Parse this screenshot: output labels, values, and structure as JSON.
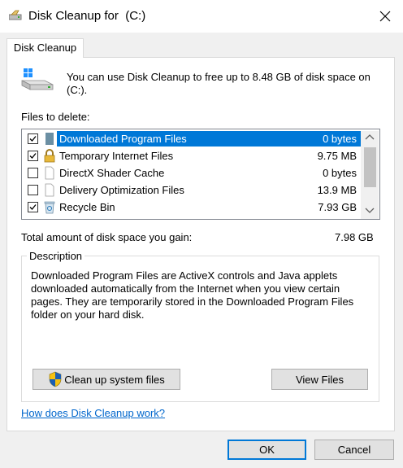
{
  "window": {
    "title": "Disk Cleanup for  (C:)",
    "icon": "disk-cleanup-icon",
    "close_icon": "close-icon"
  },
  "tabs": [
    {
      "label": "Disk Cleanup",
      "active": true
    }
  ],
  "intro_text": "You can use Disk Cleanup to free up to 8.48 GB of disk space on (C:).",
  "files_label": "Files to delete:",
  "files": [
    {
      "name": "Downloaded Program Files",
      "size": "0 bytes",
      "checked": true,
      "selected": true,
      "icon": "folder-icon"
    },
    {
      "name": "Temporary Internet Files",
      "size": "9.75 MB",
      "checked": true,
      "selected": false,
      "icon": "lock-icon"
    },
    {
      "name": "DirectX Shader Cache",
      "size": "0 bytes",
      "checked": false,
      "selected": false,
      "icon": "file-icon"
    },
    {
      "name": "Delivery Optimization Files",
      "size": "13.9 MB",
      "checked": false,
      "selected": false,
      "icon": "file-icon"
    },
    {
      "name": "Recycle Bin",
      "size": "7.93 GB",
      "checked": true,
      "selected": false,
      "icon": "recycle-bin-icon"
    }
  ],
  "total_label": "Total amount of disk space you gain:",
  "total_value": "7.98 GB",
  "description": {
    "title": "Description",
    "text": "Downloaded Program Files are ActiveX controls and Java applets downloaded automatically from the Internet when you view certain pages. They are temporarily stored in the Downloaded Program Files folder on your hard disk."
  },
  "buttons": {
    "cleanup_system": "Clean up system files",
    "view_files": "View Files",
    "ok": "OK",
    "cancel": "Cancel"
  },
  "help_link": "How does Disk Cleanup work?",
  "colors": {
    "selection": "#0078d7",
    "link": "#0066cc",
    "shield_blue": "#1a5fb4",
    "shield_yellow": "#f5c211"
  }
}
